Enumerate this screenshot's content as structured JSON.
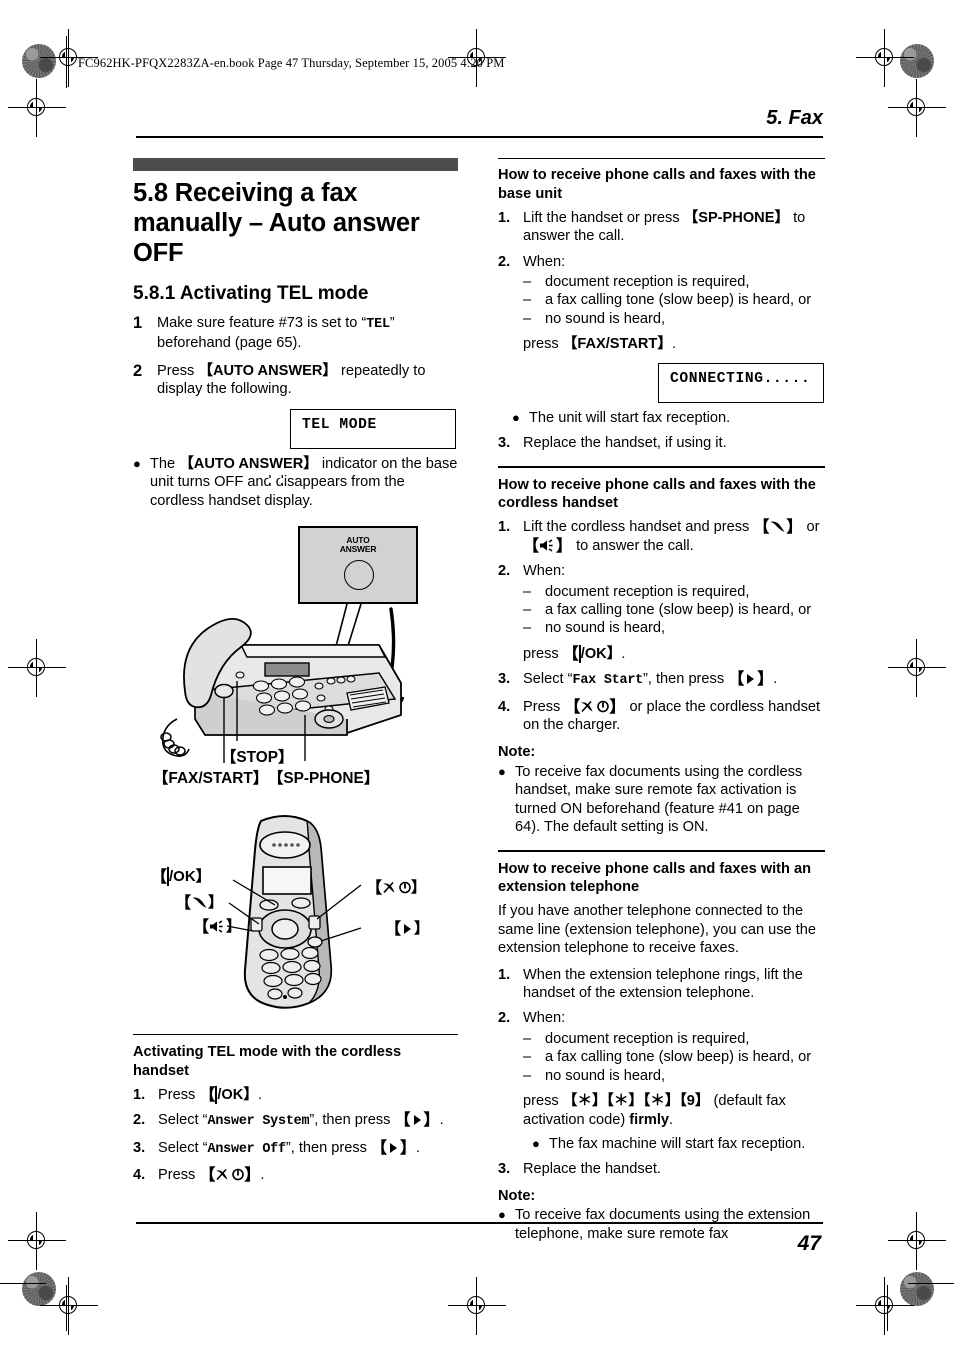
{
  "page": {
    "file_header": "FC962HK-PFQX2283ZA-en.book  Page 47  Thursday, September 15, 2005  4:20 PM",
    "running_head": "5. Fax",
    "page_number": "47"
  },
  "left_column": {
    "section_title": "5.8 Receiving a fax manually – Auto answer OFF",
    "subsection_title": "5.8.1 Activating TEL mode",
    "steps": [
      {
        "num": "1",
        "text_before": "Make sure feature #73 is set to “",
        "mono": "TEL",
        "text_after": "” beforehand (page 65)."
      },
      {
        "num": "2",
        "text_before": "Press ",
        "key": "【AUTO ANSWER】",
        "text_after": " repeatedly to display the following."
      }
    ],
    "lcd_tel_mode": "TEL MODE",
    "bullet_indicator": {
      "pre": "The ",
      "key": "【AUTO ANSWER】",
      "mid": " indicator on the base unit turns OFF and ",
      "icon": "tape-icon",
      "post": " disappears from the cordless handset display."
    },
    "figure_base_unit": {
      "callout_label_line1": "AUTO",
      "callout_label_line2": "ANSWER",
      "label_stop": "【STOP】",
      "label_fax_start": "【FAX/START】",
      "label_sp_phone": "【SP-PHONE】"
    },
    "figure_handset": {
      "label_menu_ok": "/OK】",
      "label_talk": "】",
      "label_speaker": "】",
      "label_off_power": "】",
      "label_right": "】"
    },
    "cordless_block": {
      "title": "Activating TEL mode with the cordless handset",
      "steps": [
        {
          "num": "1.",
          "pre": "Press ",
          "key_icon": "menu-ok-icon",
          "key_text": "/OK】",
          "post": "."
        },
        {
          "num": "2.",
          "pre": "Select “",
          "mono": "Answer System",
          "mid": "”, then press ",
          "key_icon": "right-arrow-icon",
          "post": "."
        },
        {
          "num": "3.",
          "pre": "Select “",
          "mono": "Answer Off",
          "mid": "”, then press ",
          "key_icon": "right-arrow-icon",
          "post": "."
        },
        {
          "num": "4.",
          "pre": "Press ",
          "key_icon": "off-power-icon",
          "post": "."
        }
      ]
    }
  },
  "right_column": {
    "base_unit_block": {
      "title": "How to receive phone calls and faxes with the base unit",
      "step1": {
        "num": "1.",
        "pre": "Lift the handset or press ",
        "key": "【SP-PHONE】",
        "post": " to answer the call."
      },
      "step2_label": {
        "num": "2.",
        "text": "When:"
      },
      "conditions": [
        "document reception is required,",
        "a fax calling tone (slow beep) is heard, or",
        "no sound is heard,"
      ],
      "press_line": {
        "pre": "press ",
        "key": "【FAX/START】",
        "post": "."
      },
      "lcd_connecting": "CONNECTING.....",
      "bullet": "The unit will start fax reception.",
      "step3": {
        "num": "3.",
        "text": "Replace the handset, if using it."
      }
    },
    "cordless_block": {
      "title": "How to receive phone calls and faxes with the cordless handset",
      "step1": {
        "num": "1.",
        "pre": "Lift the cordless handset and press ",
        "mid": " or ",
        "post": " to answer the call."
      },
      "step2_label": {
        "num": "2.",
        "text": "When:"
      },
      "conditions": [
        "document reception is required,",
        "a fax calling tone (slow beep) is heard, or",
        "no sound is heard,"
      ],
      "press_line": {
        "pre": "press ",
        "key_text": "/OK】",
        "post": "."
      },
      "step3": {
        "num": "3.",
        "pre": "Select “",
        "mono": "Fax Start",
        "mid": "”, then press ",
        "post": "."
      },
      "step4": {
        "num": "4.",
        "pre": "Press ",
        "post": " or place the cordless handset on the charger."
      },
      "note_label": "Note:",
      "note_text": "To receive fax documents using the cordless handset, make sure remote fax activation is turned ON beforehand (feature #41 on page 64). The default setting is ON."
    },
    "extension_block": {
      "title": "How to receive phone calls and faxes with an extension telephone",
      "intro": "If you have another telephone connected to the same line (extension telephone), you can use the extension telephone to receive faxes.",
      "step1": {
        "num": "1.",
        "text": "When the extension telephone rings, lift the handset of the extension telephone."
      },
      "step2_label": {
        "num": "2.",
        "text": "When:"
      },
      "conditions": [
        "document reception is required,",
        "a fax calling tone (slow beep) is heard, or",
        "no sound is heard,"
      ],
      "press_line": {
        "pre": "press ",
        "keys": "【＊】【＊】【＊】【9】",
        "mid": " (default fax activation code) ",
        "bold": "firmly",
        "post": "."
      },
      "bullet": "The fax machine will start fax reception.",
      "step3": {
        "num": "3.",
        "text": "Replace the handset."
      },
      "note_label": "Note:",
      "note_text": "To receive fax documents using the extension telephone, make sure remote fax"
    }
  }
}
